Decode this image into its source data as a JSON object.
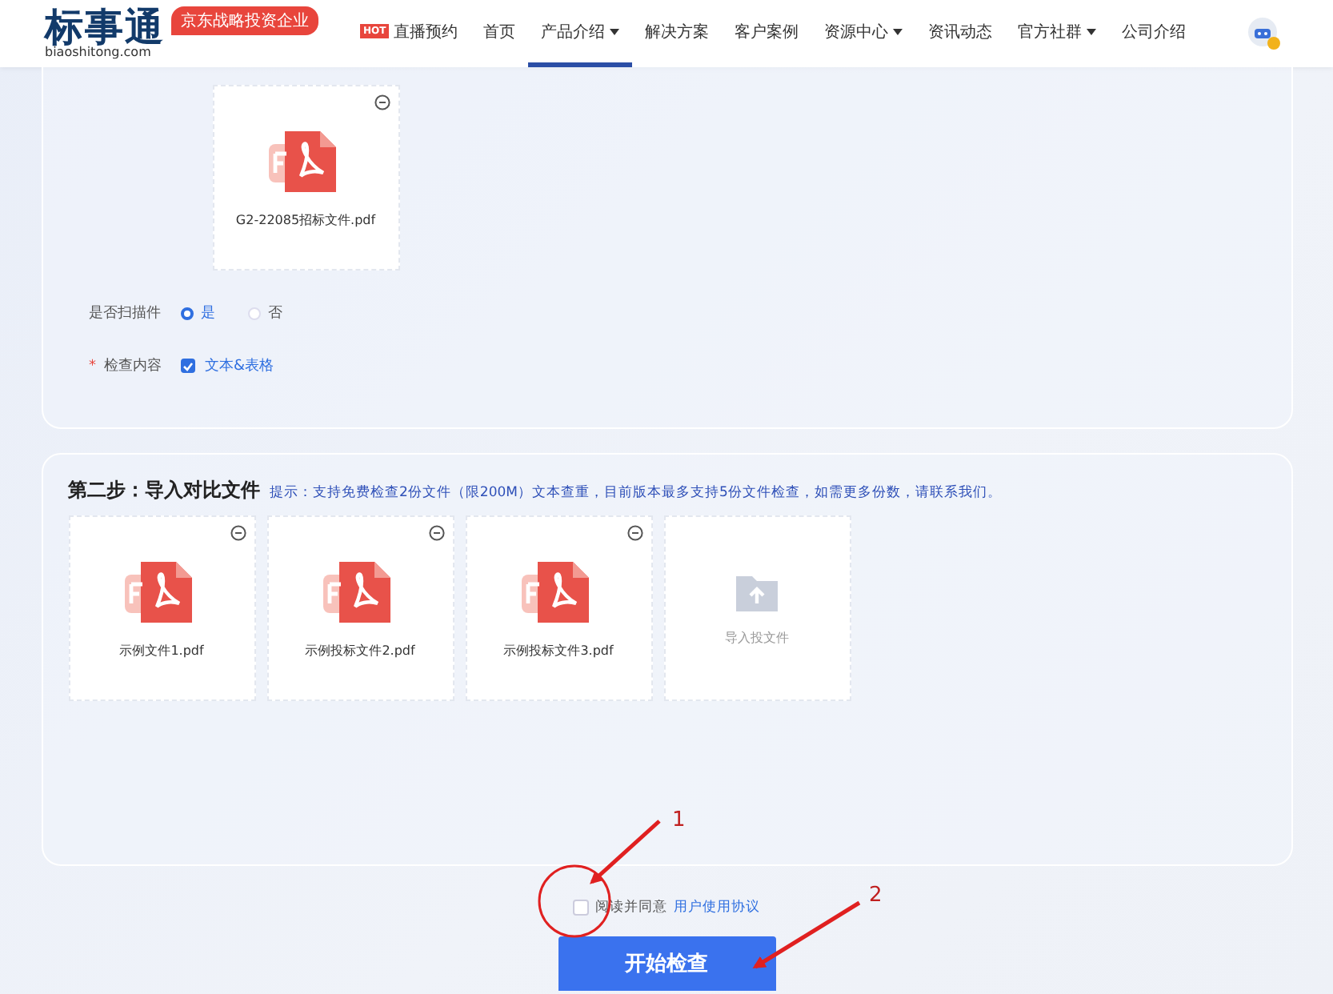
{
  "header": {
    "logo": "标事通",
    "logo_domain": "biaoshitong.com",
    "tagline": "京东战略投资企业",
    "nav": [
      {
        "label": "直播预约",
        "badge": "HOT",
        "dropdown": false,
        "selected": false
      },
      {
        "label": "首页",
        "dropdown": false,
        "selected": false
      },
      {
        "label": "产品介绍",
        "dropdown": true,
        "selected": true
      },
      {
        "label": "解决方案",
        "dropdown": false,
        "selected": false
      },
      {
        "label": "客户案例",
        "dropdown": false,
        "selected": false
      },
      {
        "label": "资源中心",
        "dropdown": true,
        "selected": false
      },
      {
        "label": "资讯动态",
        "dropdown": false,
        "selected": false
      },
      {
        "label": "官方社群",
        "dropdown": true,
        "selected": false
      },
      {
        "label": "公司介绍",
        "dropdown": false,
        "selected": false
      }
    ]
  },
  "step1": {
    "file": {
      "name": "G2-22085招标文件.pdf"
    },
    "scan": {
      "label": "是否扫描件",
      "options": [
        {
          "label": "是",
          "selected": true
        },
        {
          "label": "否",
          "selected": false
        }
      ]
    },
    "content": {
      "label": "检查内容",
      "required_mark": "*",
      "options": [
        {
          "label": "文本&表格",
          "checked": true
        }
      ]
    }
  },
  "step2": {
    "title": "第二步：导入对比文件",
    "hint": "提示：支持免费检查2份文件（限200M）文本查重，目前版本最多支持5份文件检查，如需更多份数，请联系我们。",
    "files": [
      {
        "kind": "file",
        "name": "示例文件1.pdf"
      },
      {
        "kind": "file",
        "name": "示例投标文件2.pdf"
      },
      {
        "kind": "file",
        "name": "示例投标文件3.pdf"
      },
      {
        "kind": "upload",
        "name": "导入投文件"
      }
    ]
  },
  "agreement": {
    "checked": false,
    "text": "阅读并同意",
    "link": "用户使用协议"
  },
  "submit": "开始检查",
  "annotations": [
    {
      "label": "1"
    },
    {
      "label": "2"
    }
  ]
}
